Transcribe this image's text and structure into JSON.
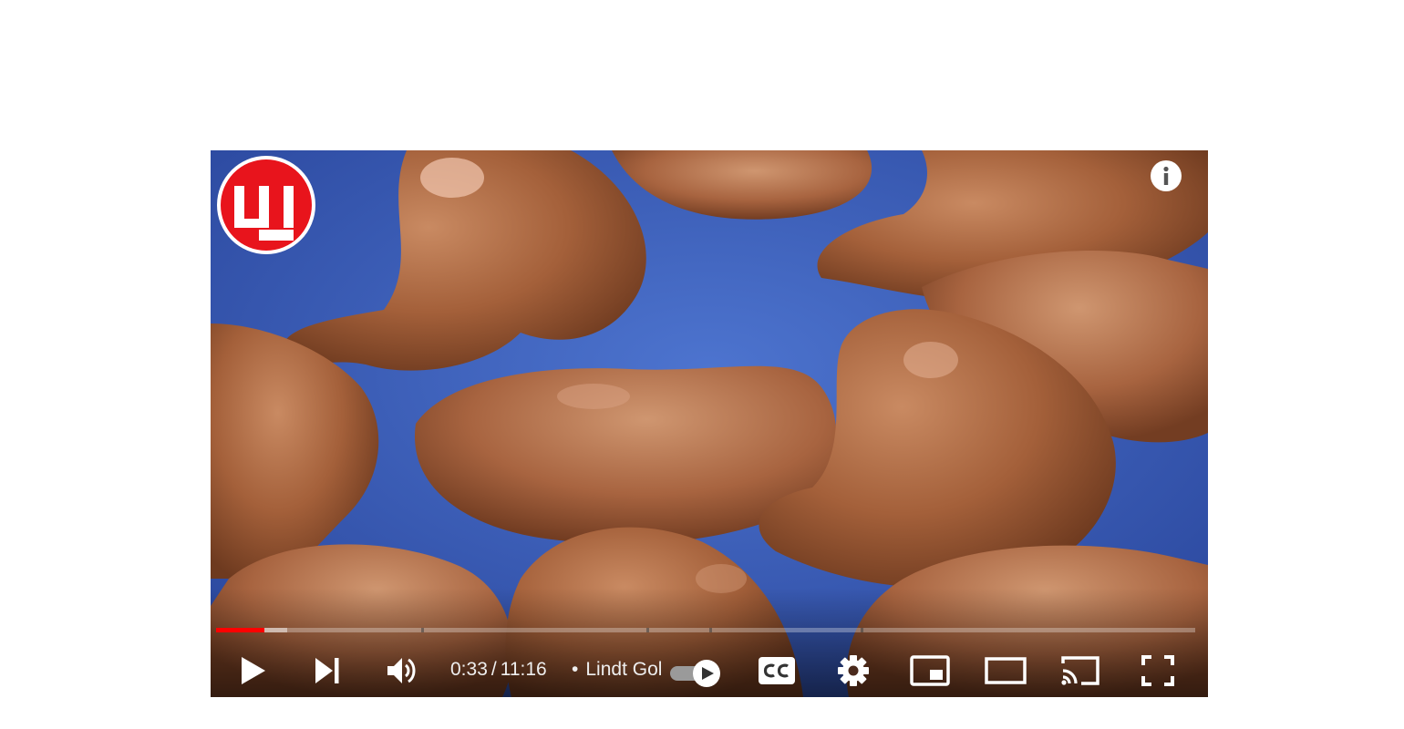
{
  "player": {
    "current_time": "0:33",
    "time_separator": "/",
    "duration": "11:16",
    "chapter_bullet": "•",
    "chapter_title": "Lindt Gold Bunny",
    "progress_played_fraction": 0.049,
    "progress_buffered_fraction": 0.073,
    "autoplay_on": true,
    "colors": {
      "progress_played": "#ff0000",
      "channel_logo": "#e8141c",
      "scene_background": "#3c5fb8",
      "chocolate": "#a4603a"
    }
  },
  "icons": {
    "play": "play-icon",
    "next": "next-icon",
    "volume": "volume-icon",
    "autoplay": "autoplay-toggle",
    "captions": "cc-icon",
    "settings": "gear-icon",
    "miniplayer": "miniplayer-icon",
    "theater": "theater-mode-icon",
    "cast": "cast-icon",
    "fullscreen": "fullscreen-icon",
    "info": "info-icon",
    "channel": "channel-logo"
  }
}
